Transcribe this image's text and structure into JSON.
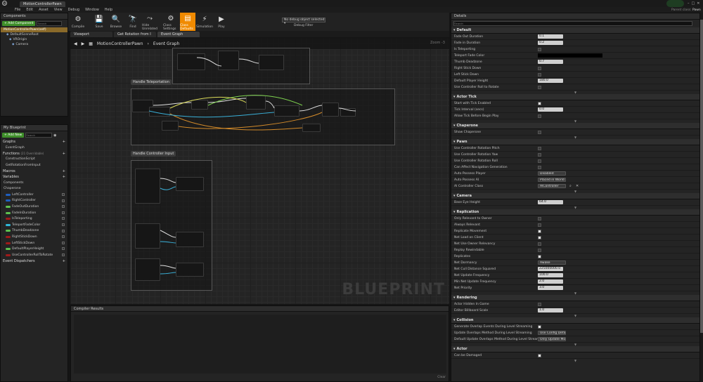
{
  "window": {
    "title": "MotionControllerPawn",
    "right_label": "Parent class:",
    "parent": "Pawn"
  },
  "menu": [
    "File",
    "Edit",
    "Asset",
    "View",
    "Debug",
    "Window",
    "Help"
  ],
  "components": {
    "tab": "Components",
    "add_label": "+ Add Component",
    "search_placeholder": "Search",
    "self": "MotionControllerPawn(self)",
    "tree": [
      "DefaultSceneRoot",
      "VROrigin",
      "Camera"
    ]
  },
  "toolbar": {
    "buttons": [
      "Compile",
      "Save",
      "Browse",
      "Find",
      "Hide Unrelated",
      "Class Settings",
      "Class Defaults",
      "Simulation",
      "Play"
    ],
    "debug_select": "No debug object selected",
    "debug_filter": "Debug Filter"
  },
  "editor_tabs": [
    "Viewport",
    "Get Rotation from I",
    "Event Graph"
  ],
  "breadcrumb": {
    "root": "MotionControllerPawn",
    "sep": "›",
    "page": "Event Graph",
    "zoom": "Zoom -3"
  },
  "graph": {
    "comment1": "Handle Teleportation",
    "comment2": "Handle Controller Input",
    "watermark": "BLUEPRINT"
  },
  "mybp": {
    "tab": "My Blueprint",
    "add_label": "+ Add New",
    "search_placeholder": "Search",
    "graphs_label": "Graphs",
    "graphs": [
      "EventGraph"
    ],
    "functions_label": "Functions",
    "functions_count": "(21 Overridable)",
    "functions": [
      "ConstructionScript",
      "GetRotationFromInput"
    ],
    "macros_label": "Macros",
    "variables_label": "Variables",
    "components_label": "Components",
    "chaperone_label": "Chaperone",
    "variables": [
      {
        "name": "LeftController",
        "color": "#1f5fbf"
      },
      {
        "name": "RightController",
        "color": "#1f5fbf"
      },
      {
        "name": "FadeOutDuration",
        "color": "#5ec24f"
      },
      {
        "name": "FadeInDuration",
        "color": "#5ec24f"
      },
      {
        "name": "IsTeleporting",
        "color": "#a01a1a"
      },
      {
        "name": "TeleportFadeColor",
        "color": "#2fb8d8"
      },
      {
        "name": "ThumbDeadzone",
        "color": "#5ec24f"
      },
      {
        "name": "RightStickDown",
        "color": "#a01a1a"
      },
      {
        "name": "LeftStickDown",
        "color": "#a01a1a"
      },
      {
        "name": "DefaultPlayerHeight",
        "color": "#5ec24f"
      },
      {
        "name": "UseControllerRollToRotate",
        "color": "#a01a1a"
      }
    ],
    "dispatchers_label": "Event Dispatchers"
  },
  "compiler": {
    "tab": "Compiler Results",
    "clear": "Clear"
  },
  "details": {
    "tab": "Details",
    "search_placeholder": "Search",
    "default_label": "Default",
    "default_rows": [
      {
        "label": "Fade Out Duration",
        "type": "num",
        "value": "0.1"
      },
      {
        "label": "Fade in Duration",
        "type": "num",
        "value": "0.2"
      },
      {
        "label": "Is Teleporting",
        "type": "cb",
        "checked": false
      },
      {
        "label": "Teleport Fade Color",
        "type": "color"
      },
      {
        "label": "Thumb Deadzone",
        "type": "num",
        "value": "0.7"
      },
      {
        "label": "Right Stick Down",
        "type": "cb",
        "checked": false
      },
      {
        "label": "Left Stick Down",
        "type": "cb",
        "checked": false
      },
      {
        "label": "Default Player Height",
        "type": "num",
        "value": "180.0"
      },
      {
        "label": "Use Controller Roll to Rotate",
        "type": "cb",
        "checked": false
      }
    ],
    "actor_tick_label": "Actor Tick",
    "actor_tick_rows": [
      {
        "label": "Start with Tick Enabled",
        "type": "cb",
        "checked": true
      },
      {
        "label": "Tick Interval (secs)",
        "type": "num",
        "value": "0.0"
      },
      {
        "label": "Allow Tick Before Begin Play",
        "type": "cb",
        "checked": false
      }
    ],
    "chaperone_label": "Chaperone",
    "chaperone_rows": [
      {
        "label": "Show Chaperone",
        "type": "cb",
        "checked": false
      }
    ],
    "pawn_label": "Pawn",
    "pawn_rows": [
      {
        "label": "Use Controller Rotation Pitch",
        "type": "cb",
        "checked": false
      },
      {
        "label": "Use Controller Rotation Yaw",
        "type": "cb",
        "checked": false
      },
      {
        "label": "Use Controller Rotation Roll",
        "type": "cb",
        "checked": false
      },
      {
        "label": "Can Affect Navigation Generation",
        "type": "cb",
        "checked": false
      },
      {
        "label": "Auto Possess Player",
        "type": "drop",
        "value": "Disabled"
      },
      {
        "label": "Auto Possess AI",
        "type": "drop",
        "value": "Placed in World"
      },
      {
        "label": "AI Controller Class",
        "type": "drop",
        "value": "AIController"
      }
    ],
    "camera_label": "Camera",
    "camera_rows": [
      {
        "label": "Base Eye Height",
        "type": "num",
        "value": "64.0"
      }
    ],
    "replication_label": "Replication",
    "replication_rows": [
      {
        "label": "Only Relevant to Owner",
        "type": "cb",
        "checked": false
      },
      {
        "label": "Always Relevant",
        "type": "cb",
        "checked": false
      },
      {
        "label": "Replicate Movement",
        "type": "cb",
        "checked": true
      },
      {
        "label": "Net Load on Client",
        "type": "cb",
        "checked": true
      },
      {
        "label": "Net Use Owner Relevancy",
        "type": "cb",
        "checked": false
      },
      {
        "label": "Replay Rewindable",
        "type": "cb",
        "checked": false
      },
      {
        "label": "Replicates",
        "type": "cb",
        "checked": true
      },
      {
        "label": "Net Dormancy",
        "type": "drop",
        "value": "Awake"
      },
      {
        "label": "Net Cull Distance Squared",
        "type": "num",
        "value": "225000000.0"
      },
      {
        "label": "Net Update Frequency",
        "type": "num",
        "value": "100.0"
      },
      {
        "label": "Min Net Update Frequency",
        "type": "num",
        "value": "2.0"
      },
      {
        "label": "Net Priority",
        "type": "num",
        "value": "3.0"
      }
    ],
    "rendering_label": "Rendering",
    "rendering_rows": [
      {
        "label": "Actor Hidden In Game",
        "type": "cb",
        "checked": false
      },
      {
        "label": "Editor Billboard Scale",
        "type": "num",
        "value": "1.0"
      }
    ],
    "collision_label": "Collision",
    "collision_rows": [
      {
        "label": "Generate Overlap Events During Level Streaming",
        "type": "cb",
        "checked": true
      },
      {
        "label": "Update Overlaps Method During Level Streaming",
        "type": "drop",
        "value": "Use Config Default"
      },
      {
        "label": "Default Update Overlaps Method During Level Streaming",
        "type": "drop",
        "value": "Only Update Movable"
      }
    ],
    "actor_label": "Actor",
    "actor_rows": [
      {
        "label": "Can be Damaged",
        "type": "cb",
        "checked": true
      }
    ]
  }
}
